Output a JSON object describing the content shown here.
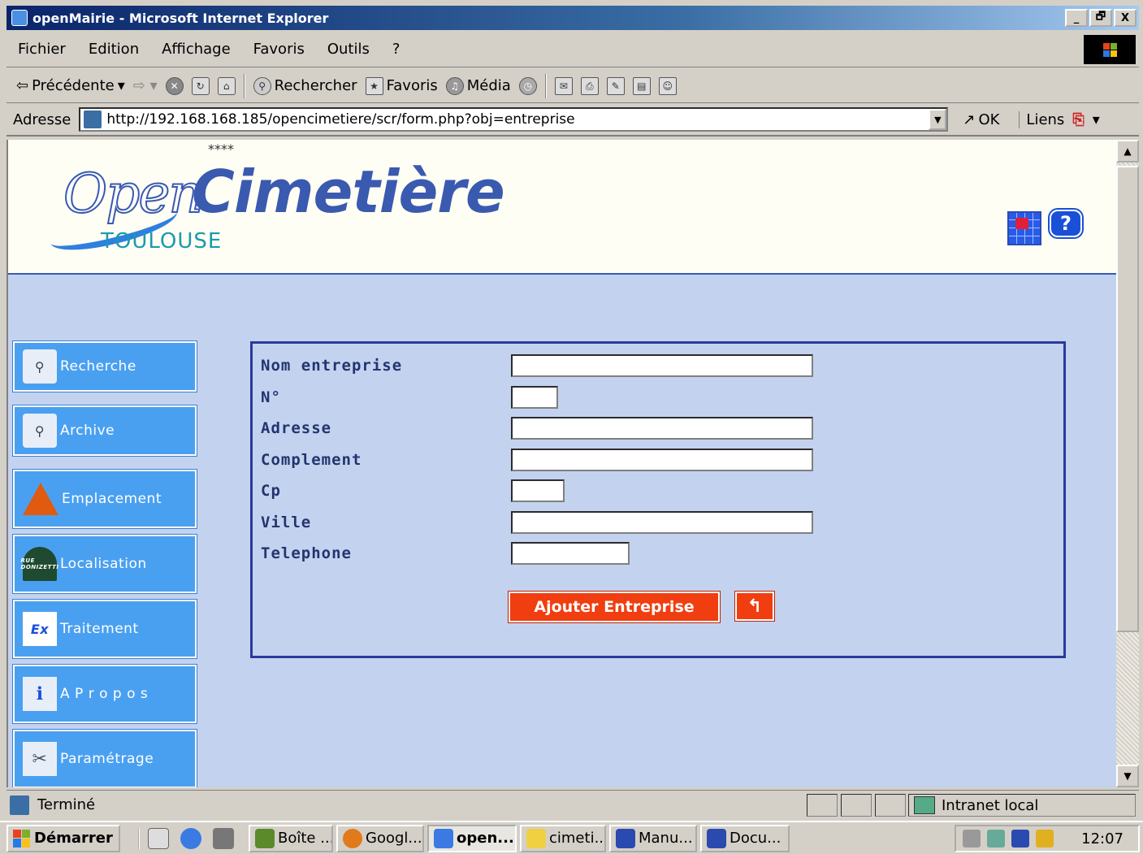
{
  "window": {
    "title": "openMairie - Microsoft Internet Explorer",
    "minimize": "_",
    "maximize": "🗗",
    "close": "X"
  },
  "menu": {
    "items": [
      "Fichier",
      "Edition",
      "Affichage",
      "Favoris",
      "Outils",
      "?"
    ]
  },
  "toolbar": {
    "back": "Précédente",
    "search": "Rechercher",
    "favorites": "Favoris",
    "media": "Média"
  },
  "address": {
    "label": "Adresse",
    "url": "http://192.168.168.185/opencimetiere/scr/form.php?obj=entreprise",
    "go": "OK",
    "links": "Liens"
  },
  "header": {
    "stars": "****",
    "logo_open": "Open",
    "logo_cimetiere": "Cimetière",
    "logo_city": "TOULOUSE",
    "help_glyph": "?"
  },
  "sidebar": {
    "items": [
      {
        "label": "Recherche",
        "icon": "search-icon"
      },
      {
        "label": "Archive",
        "icon": "search-icon"
      },
      {
        "label": "Emplacement",
        "icon": "pyramid-icon"
      },
      {
        "label": "Localisation",
        "icon": "street-sign-icon",
        "icon_text": "RUE DONIZETTI"
      },
      {
        "label": "Traitement",
        "icon": "ex-icon",
        "icon_text": "Ex"
      },
      {
        "label": "A P r o p o s",
        "icon": "info-icon"
      },
      {
        "label": "Paramétrage",
        "icon": "tools-icon"
      }
    ]
  },
  "form": {
    "fields": [
      {
        "label": "Nom entreprise",
        "value": ""
      },
      {
        "label": "N°",
        "value": ""
      },
      {
        "label": "Adresse",
        "value": ""
      },
      {
        "label": "Complement",
        "value": ""
      },
      {
        "label": "Cp",
        "value": ""
      },
      {
        "label": "Ville",
        "value": ""
      },
      {
        "label": "Telephone",
        "value": ""
      }
    ],
    "submit_label": "Ajouter Entreprise",
    "back_glyph": "↰"
  },
  "status": {
    "text": "Terminé",
    "zone": "Intranet local"
  },
  "taskbar": {
    "start": "Démarrer",
    "tasks": [
      "Boîte ...",
      "Googl...",
      "open...",
      "cimeti...",
      "Manu...",
      "Docu..."
    ],
    "clock": "12:07"
  },
  "colors": {
    "titlebar": "#0a246a",
    "page_background": "#c3d3ef",
    "sidebar_button": "#4aa0f0",
    "form_border": "#2a3a9a",
    "submit_button": "#f03e10",
    "label_text": "#23346e"
  }
}
